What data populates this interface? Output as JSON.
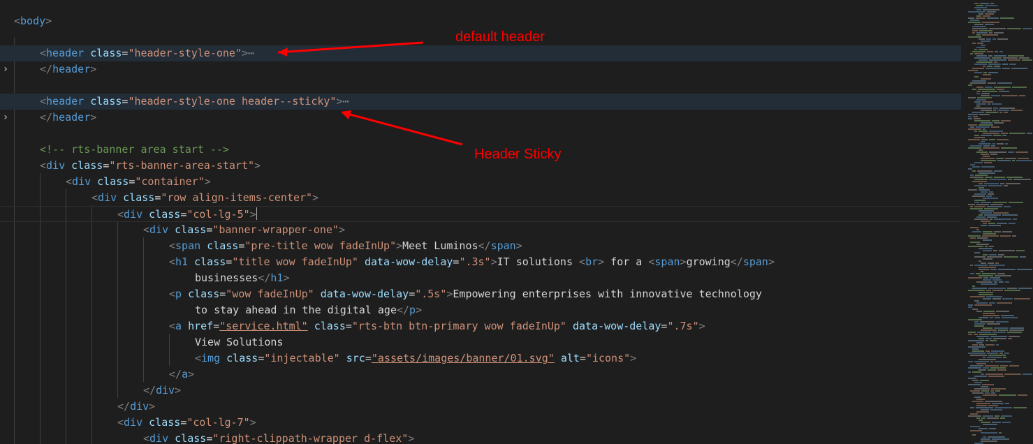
{
  "annotations": {
    "default_header": "default header",
    "header_sticky": "Header Sticky"
  },
  "icons": {
    "fold": "chevron-right-icon",
    "ellipsis": "ellipsis-icon"
  },
  "colors": {
    "background": "#1e1e1e",
    "tag": "#569cd6",
    "attribute": "#9cdcfe",
    "value": "#ce9178",
    "comment": "#6a9955",
    "annotation": "#ff0000"
  },
  "code": {
    "body_open": "body",
    "header1_tag": "header",
    "header1_attr": "class",
    "header1_val": "\"header-style-one\"",
    "header1_close": "header",
    "header2_tag": "header",
    "header2_attr": "class",
    "header2_val": "\"header-style-one header--sticky\"",
    "header2_close": "header",
    "comment": "<!-- rts-banner area start -->",
    "div1_tag": "div",
    "div1_attr": "class",
    "div1_val": "\"rts-banner-area-start\"",
    "div2_tag": "div",
    "div2_attr": "class",
    "div2_val": "\"container\"",
    "div3_tag": "div",
    "div3_attr": "class",
    "div3_val": "\"row align-items-center\"",
    "div4_tag": "div",
    "div4_attr": "class",
    "div4_val": "\"col-lg-5\"",
    "div5_tag": "div",
    "div5_attr": "class",
    "div5_val": "\"banner-wrapper-one\"",
    "span_tag": "span",
    "span_attr": "class",
    "span_val": "\"pre-title wow fadeInUp\"",
    "span_text": "Meet Luminos",
    "span_close": "span",
    "h1_tag": "h1",
    "h1_attr1": "class",
    "h1_val1": "\"title wow fadeInUp\"",
    "h1_attr2": "data-wow-delay",
    "h1_val2": "\".3s\"",
    "h1_text1": "IT solutions ",
    "br_tag": "br",
    "h1_text2": " for a ",
    "h1_span_tag": "span",
    "h1_span_text": "growing",
    "h1_span_close": "span",
    "h1_text3": "businesses",
    "h1_close": "h1",
    "p_tag": "p",
    "p_attr1": "class",
    "p_val1": "\"wow fadeInUp\"",
    "p_attr2": "data-wow-delay",
    "p_val2": "\".5s\"",
    "p_text1": "Empowering enterprises with innovative technology",
    "p_text2": "to stay ahead in the digital age",
    "p_close": "p",
    "a_tag": "a",
    "a_attr1": "href",
    "a_val1": "\"service.html\"",
    "a_attr2": "class",
    "a_val2": "\"rts-btn btn-primary wow fadeInUp\"",
    "a_attr3": "data-wow-delay",
    "a_val3": "\".7s\"",
    "a_text": "View Solutions",
    "img_tag": "img",
    "img_attr1": "class",
    "img_val1": "\"injectable\"",
    "img_attr2": "src",
    "img_val2": "\"assets/images/banner/01.svg\"",
    "img_attr3": "alt",
    "img_val3": "\"icons\"",
    "a_close": "a",
    "div5_close": "div",
    "div4_close": "div",
    "div6_tag": "div",
    "div6_attr": "class",
    "div6_val": "\"col-lg-7\"",
    "div7_tag": "div",
    "div7_attr": "class",
    "div7_val": "\"right-clippath-wrapper d-flex\""
  }
}
